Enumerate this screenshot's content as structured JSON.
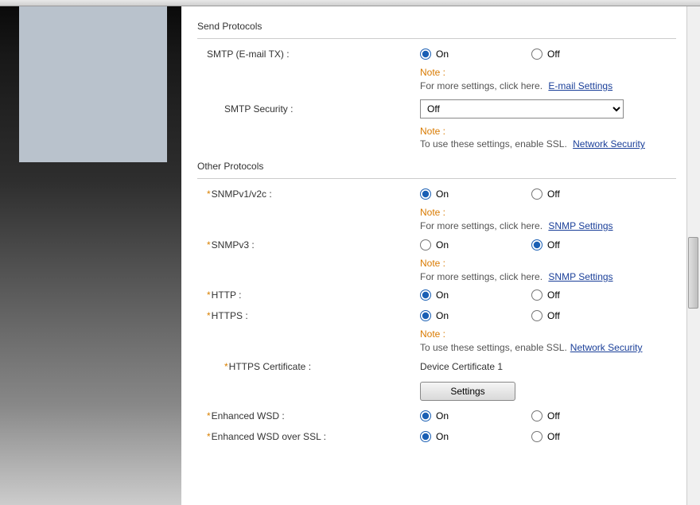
{
  "sections": {
    "send": "Send Protocols",
    "other": "Other Protocols"
  },
  "rows": {
    "smtp": {
      "label": "SMTP (E-mail TX) :",
      "on": "On",
      "off": "Off",
      "selected": "on"
    },
    "smtp_note": {
      "label": "Note :",
      "text": "For more settings, click here.",
      "link": "E-mail Settings"
    },
    "smtp_sec": {
      "label": "SMTP Security :",
      "value": "Off"
    },
    "smtp_sec_note": {
      "label": "Note :",
      "text": "To use these settings, enable SSL.",
      "link": "Network Security"
    },
    "snmp12": {
      "label": "SNMPv1/v2c :",
      "on": "On",
      "off": "Off",
      "selected": "on"
    },
    "snmp12_note": {
      "label": "Note :",
      "text": "For more settings, click here.",
      "link": "SNMP Settings"
    },
    "snmp3": {
      "label": "SNMPv3 :",
      "on": "On",
      "off": "Off",
      "selected": "off"
    },
    "snmp3_note": {
      "label": "Note :",
      "text": "For more settings, click here.",
      "link": "SNMP Settings"
    },
    "http": {
      "label": "HTTP :",
      "on": "On",
      "off": "Off",
      "selected": "on"
    },
    "https": {
      "label": "HTTPS :",
      "on": "On",
      "off": "Off",
      "selected": "on"
    },
    "https_note": {
      "label": "Note :",
      "text": "To use these settings, enable SSL.",
      "link": "Network Security"
    },
    "https_cert": {
      "label": "HTTPS Certificate :",
      "value": "Device Certificate 1"
    },
    "settings_btn": "Settings",
    "ewsd": {
      "label": "Enhanced WSD :",
      "on": "On",
      "off": "Off",
      "selected": "on"
    },
    "ewsd_ssl": {
      "label": "Enhanced WSD over SSL :",
      "on": "On",
      "off": "Off",
      "selected": "on"
    }
  }
}
